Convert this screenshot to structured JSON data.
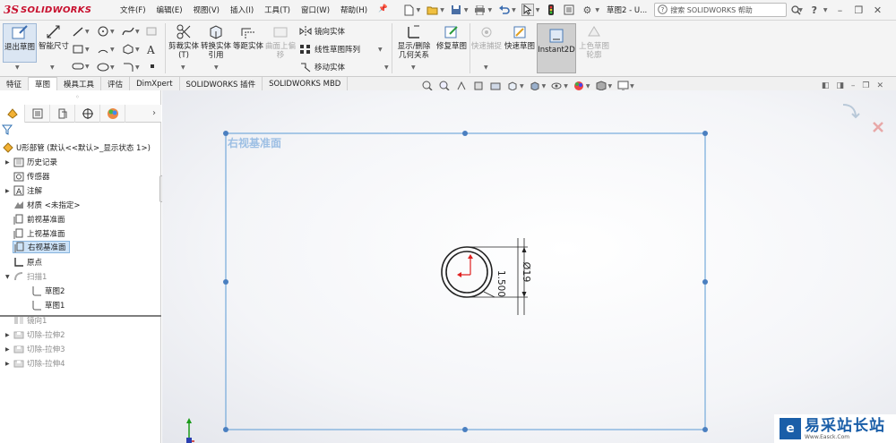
{
  "app": {
    "logo_ds": "3S",
    "logo_name": "SOLIDWORKS",
    "doc_title": "草图2 - U...",
    "help_search_placeholder": "搜索 SOLIDWORKS 帮助"
  },
  "menus": [
    "文件(F)",
    "编辑(E)",
    "视图(V)",
    "插入(I)",
    "工具(T)",
    "窗口(W)",
    "帮助(H)"
  ],
  "commands": {
    "exit_sketch": "退出草图",
    "smart_dim": "智能尺寸",
    "trim": "剪裁实体(T)",
    "convert": "转换实体引用",
    "offset": "等距实体",
    "surface_offset": "曲面上偏移",
    "mirror": "镜向实体",
    "linear_pattern": "线性草图阵列",
    "move": "移动实体",
    "display_delete_relations": "显示/删除几何关系",
    "repair_sketch": "修复草图",
    "quick_snaps": "快速捕捉",
    "rapid_sketch": "快速草图",
    "instant2d": "Instant2D",
    "shaded_contours": "上色草图轮廓"
  },
  "tabs": [
    "特征",
    "草图",
    "模具工具",
    "评估",
    "DimXpert",
    "SOLIDWORKS 插件",
    "SOLIDWORKS MBD"
  ],
  "tree": {
    "root": "U形部管 (默认<<默认>_显示状态 1>)",
    "items": [
      {
        "label": "历史记录"
      },
      {
        "label": "传感器"
      },
      {
        "label": "注解"
      },
      {
        "label": "材质 <未指定>"
      },
      {
        "label": "前视基准面"
      },
      {
        "label": "上视基准面"
      },
      {
        "label": "右视基准面"
      },
      {
        "label": "原点"
      },
      {
        "label": "扫描1"
      },
      {
        "label": "草图2"
      },
      {
        "label": "草图1"
      },
      {
        "label": "镜向1"
      },
      {
        "label": "切除-拉伸2"
      },
      {
        "label": "切除-拉伸3"
      },
      {
        "label": "切除-拉伸4"
      }
    ]
  },
  "viewport": {
    "plane_label": "右视基准面",
    "dim_diameter": "Ø19",
    "dim_thickness": "1.500"
  },
  "watermark": {
    "main": "易采站长站",
    "sub": "Www.Easck.Com"
  },
  "colors": {
    "accent_red": "#c8102e",
    "selection_blue": "#5b9bd5",
    "plane_label": "#9dbfe4"
  }
}
